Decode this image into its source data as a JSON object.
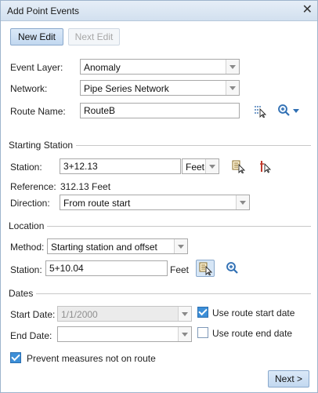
{
  "window": {
    "title": "Add Point Events"
  },
  "toolbar": {
    "new_edit_label": "New Edit",
    "next_edit_label": "Next Edit"
  },
  "form": {
    "event_layer_label": "Event Layer:",
    "event_layer_value": "Anomaly",
    "network_label": "Network:",
    "network_value": "Pipe Series Network",
    "route_name_label": "Route Name:",
    "route_name_value": "RouteB"
  },
  "starting_station": {
    "section_label": "Starting Station",
    "station_label": "Station:",
    "station_value": "3+12.13",
    "units_value": "Feet",
    "reference_label": "Reference:",
    "reference_value": "312.13 Feet",
    "direction_label": "Direction:",
    "direction_value": "From route start"
  },
  "location": {
    "section_label": "Location",
    "method_label": "Method:",
    "method_value": "Starting station and offset",
    "station_label": "Station:",
    "station_value": "5+10.04",
    "units_label": "Feet"
  },
  "dates": {
    "section_label": "Dates",
    "start_date_label": "Start Date:",
    "start_date_value": "1/1/2000",
    "use_route_start_label": "Use route start date",
    "use_route_start_checked": true,
    "end_date_label": "End Date:",
    "end_date_value": "",
    "use_route_end_label": "Use route end date",
    "use_route_end_checked": false
  },
  "options": {
    "prevent_measures_label": "Prevent measures not on route",
    "prevent_measures_checked": true
  },
  "footer": {
    "next_label": "Next >"
  },
  "icons": {
    "close": "close-icon",
    "route_select": "route-select-icon",
    "zoom": "zoom-icon",
    "station_select": "station-select-icon",
    "station_pick": "station-pick-icon",
    "location_select": "location-select-icon",
    "location_zoom": "location-zoom-icon"
  },
  "colors": {
    "accent": "#3d8fd8",
    "header": "#d2e0ef",
    "border": "#9eb4cc"
  }
}
